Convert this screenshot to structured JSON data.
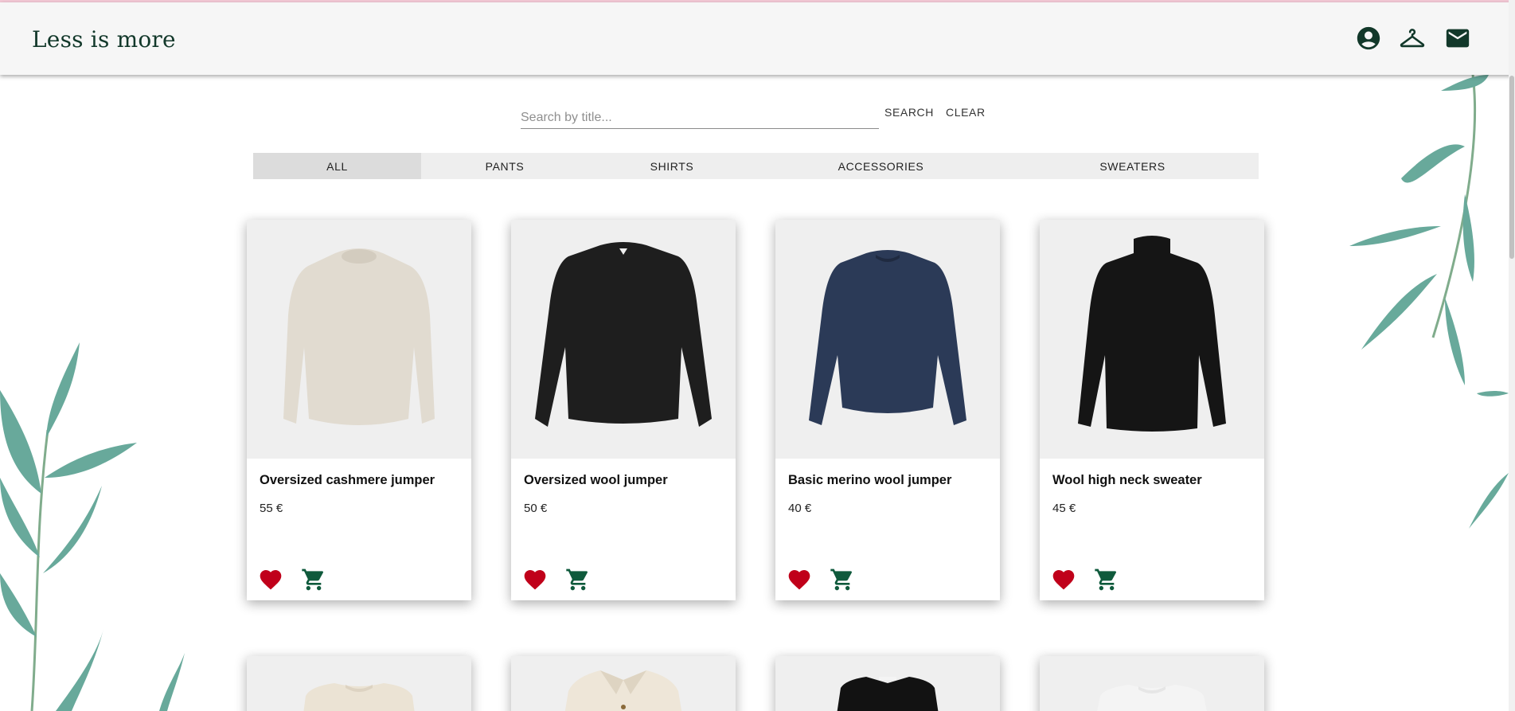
{
  "header": {
    "logo": "Less is more",
    "icons": [
      "account-circle-icon",
      "hanger-icon",
      "mail-icon"
    ]
  },
  "search": {
    "placeholder": "Search by title...",
    "value": "",
    "search_label": "SEARCH",
    "clear_label": "CLEAR"
  },
  "tabs": [
    {
      "label": "ALL",
      "active": true
    },
    {
      "label": "PANTS",
      "active": false
    },
    {
      "label": "SHIRTS",
      "active": false
    },
    {
      "label": "ACCESSORIES",
      "active": false
    },
    {
      "label": "SWEATERS",
      "active": false
    }
  ],
  "products": [
    {
      "title": "Oversized cashmere jumper",
      "price": "55 €",
      "color": "#e1dbd0"
    },
    {
      "title": "Oversized wool jumper",
      "price": "50 €",
      "color": "#1e1e1e"
    },
    {
      "title": "Basic merino wool jumper",
      "price": "40 €",
      "color": "#2b3a57"
    },
    {
      "title": "Wool high neck sweater",
      "price": "45 €",
      "color": "#151515"
    }
  ],
  "products_row2": [
    {
      "color": "#ebe3d4"
    },
    {
      "color": "#eee6d8"
    },
    {
      "color": "#121212"
    },
    {
      "color": "#f4f4f4"
    }
  ],
  "colors": {
    "brand": "#12382a",
    "heart": "#c0001a",
    "cart": "#0f5a3c",
    "leaf": "#4e9b8a"
  }
}
